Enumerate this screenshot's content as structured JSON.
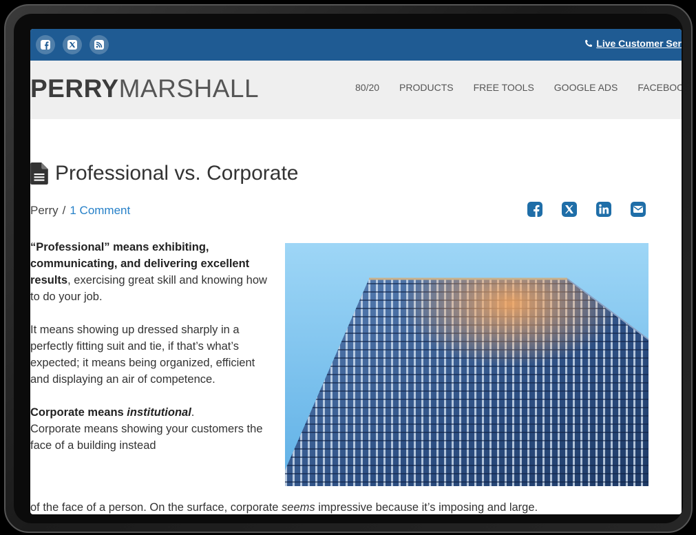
{
  "topbar": {
    "social_icons": [
      "facebook-icon",
      "x-icon",
      "rss-icon"
    ],
    "live_link": "Live Customer Ser"
  },
  "header": {
    "logo_bold": "PERRY",
    "logo_light": "MARSHALL",
    "nav": [
      "80/20",
      "PRODUCTS",
      "FREE TOOLS",
      "GOOGLE ADS",
      "FACEBOO"
    ]
  },
  "post": {
    "title": "Professional vs. Corporate",
    "author": "Perry",
    "separator": "/",
    "comments": "1 Comment",
    "share_icons": [
      "facebook-icon",
      "x-icon",
      "linkedin-icon",
      "email-icon"
    ],
    "p1_bold": "“Professional” means exhibiting, communicating, and delivering excellent results",
    "p1_rest": ", exercising great skill and knowing how to do your job.",
    "p2": "It means showing up dressed sharply in a perfectly fitting suit and tie, if that’s what’s expected; it means being organized, efficient and displaying an air of competence.",
    "p3_bold": "Corporate means ",
    "p3_bold_italic": "institutional",
    "p3_dot": ".",
    "p3_rest": "Corporate means showing your customers the face of a building instead",
    "p3_wide_a": "of the face of a person. On the surface, corporate ",
    "p3_wide_em": "seems",
    "p3_wide_b": " impressive because it’s imposing and large."
  },
  "colors": {
    "topbar": "#1f5b93",
    "header_bg": "#efefef",
    "link": "#2680c8",
    "share_icon": "#1f6ea8"
  }
}
